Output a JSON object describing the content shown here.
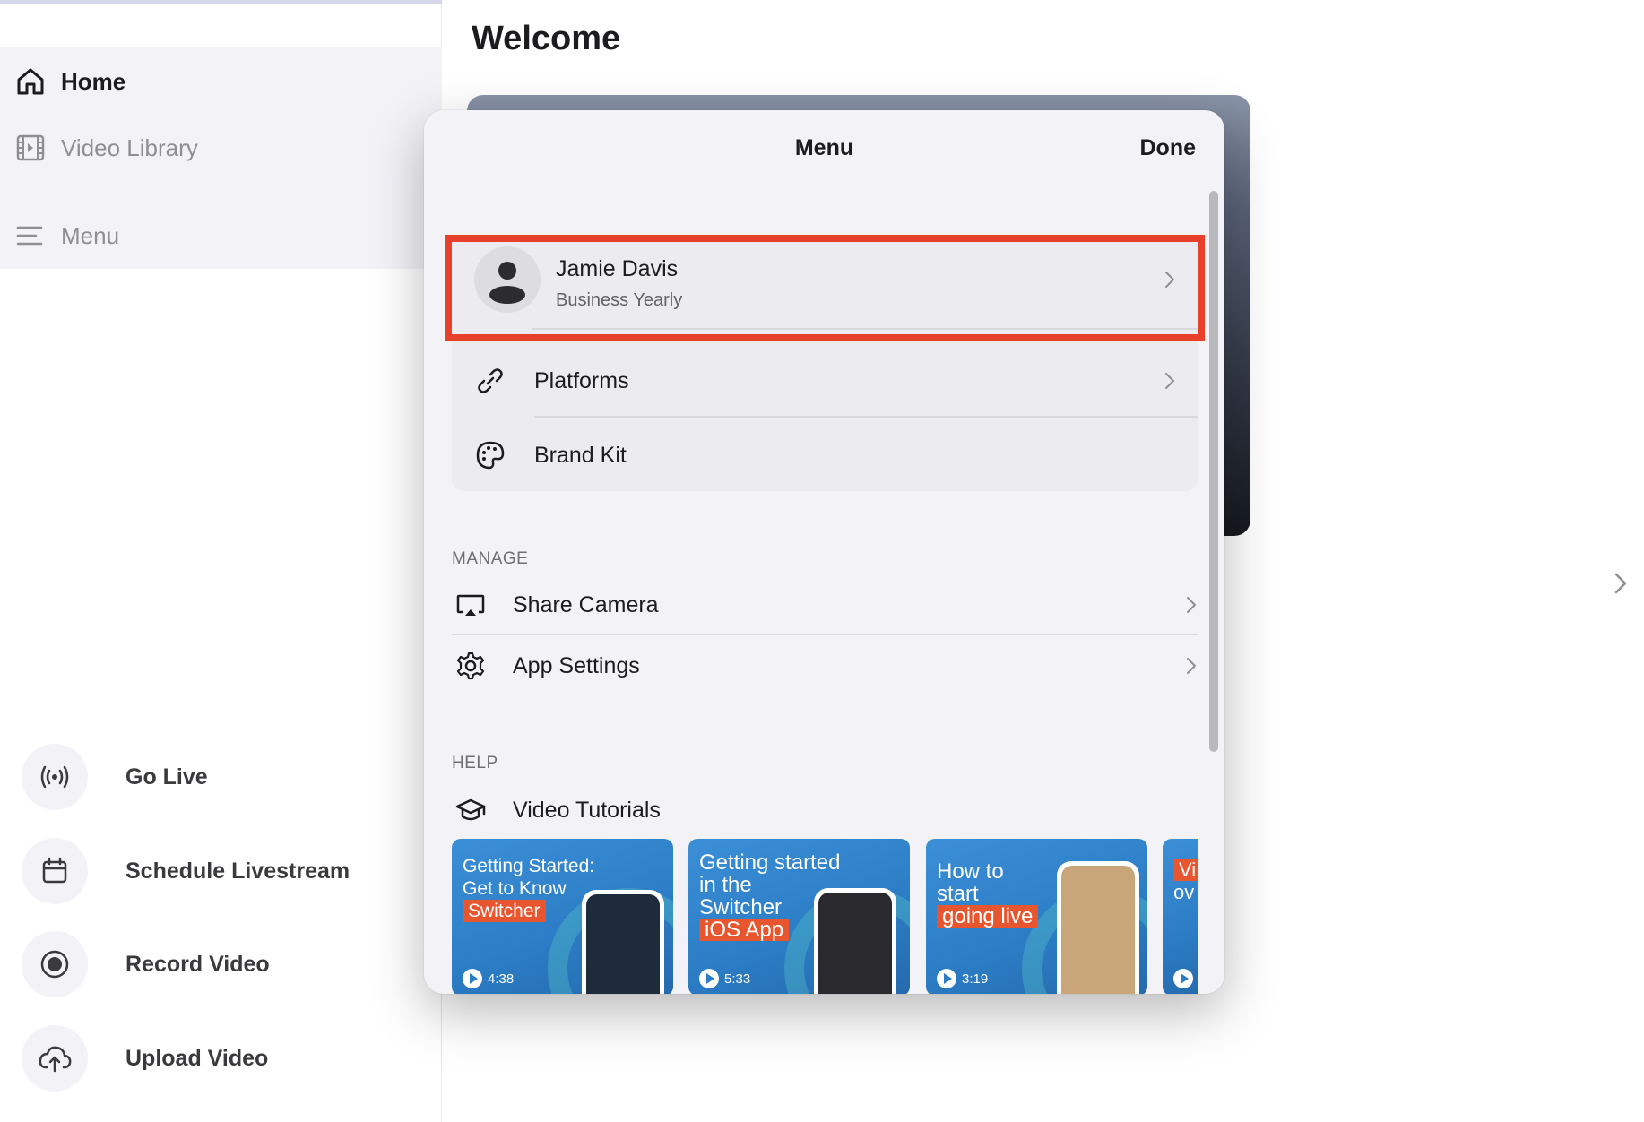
{
  "sidebar": {
    "nav": [
      {
        "label": "Home",
        "icon": "home-icon",
        "active": true
      },
      {
        "label": "Video Library",
        "icon": "film-icon",
        "active": false
      },
      {
        "label": "Menu",
        "icon": "menu-lines-icon",
        "active": false
      }
    ],
    "actions": [
      {
        "label": "Go Live",
        "icon": "broadcast-icon"
      },
      {
        "label": "Schedule Livestream",
        "icon": "calendar-icon"
      },
      {
        "label": "Record Video",
        "icon": "record-icon"
      },
      {
        "label": "Upload Video",
        "icon": "cloud-upload-icon"
      }
    ]
  },
  "main": {
    "title": "Welcome"
  },
  "menu_modal": {
    "title": "Menu",
    "done_label": "Done",
    "profile": {
      "name": "Jamie Davis",
      "plan": "Business Yearly"
    },
    "account_rows": [
      {
        "label": "Platforms",
        "icon": "link-icon"
      },
      {
        "label": "Brand Kit",
        "icon": "palette-icon"
      }
    ],
    "manage": {
      "header": "MANAGE",
      "rows": [
        {
          "label": "Share Camera",
          "icon": "airplay-icon"
        },
        {
          "label": "App Settings",
          "icon": "gear-icon"
        }
      ]
    },
    "help": {
      "header": "HELP",
      "rows": [
        {
          "label": "Video Tutorials",
          "icon": "graduation-cap-icon"
        }
      ],
      "tutorials": [
        {
          "line1": "Getting Started:",
          "line2": "Get to Know",
          "tag": "Switcher",
          "duration": "4:38"
        },
        {
          "line1": "Getting started",
          "line2": "in the",
          "line3": "Switcher",
          "tag": "iOS App",
          "duration": "5:33"
        },
        {
          "line1": "How to",
          "line2": "start",
          "tag": "going live",
          "duration": "3:19"
        },
        {
          "line1": "Vi",
          "line2": "ov"
        }
      ]
    }
  },
  "colors": {
    "highlight": "#e8402a",
    "panel_bg": "#f2f2f7",
    "thumb_blue": "#2b7cc4",
    "thumb_orange": "#e8562f"
  }
}
